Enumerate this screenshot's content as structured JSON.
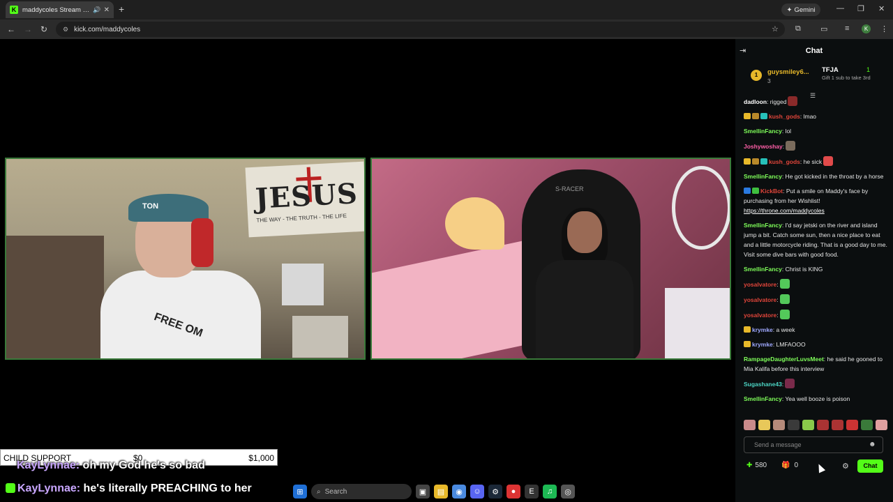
{
  "browser": {
    "tab_title": "maddycoles Stream - Watc",
    "favicon_letter": "K",
    "url": "kick.com/maddycoles",
    "gemini_label": "Gemini",
    "profile_initial": "K"
  },
  "overlay": {
    "support_label": "CHILD SUPPORT",
    "support_current": "$0",
    "support_goal": "$1,000",
    "lines": [
      {
        "name": "KayLynnae:",
        "text": " oh my God he's so bad"
      },
      {
        "name": "KayLynnae:",
        "text": " he's literally PREACHING to her"
      }
    ]
  },
  "cams": {
    "left_flag_text": "JESUS",
    "left_flag_sub": "THE WAY - THE TRUTH - THE LIFE",
    "left_cap_text": "TON",
    "left_shirt_text": "FREE  OM",
    "right_chair_text": "S-RACER"
  },
  "taskbar": {
    "search_placeholder": "Search"
  },
  "chat": {
    "title": "Chat",
    "leaderboard": {
      "first_rank": "1",
      "first_name": "guysmiley6...",
      "first_count": "3",
      "second_name": "TFJA",
      "second_count": "1",
      "second_sub": "Gift 1 sub to take 3rd"
    },
    "messages": [
      {
        "user": "dadloon",
        "color": "#ffffff",
        "text": " rigged",
        "badges": [],
        "emote": "#8a2a2a"
      },
      {
        "user": "kush_gods",
        "color": "#e0453a",
        "text": " lmao",
        "badges": [
          "#e8b92a",
          "#b9892a",
          "#27c0b9"
        ],
        "emote": ""
      },
      {
        "user": "SmellinFancy",
        "color": "#7fff5a",
        "text": " lol",
        "badges": [],
        "emote": ""
      },
      {
        "user": "Joshywoshay",
        "color": "#ff5fa8",
        "text": "",
        "badges": [],
        "emote": "#7a6b5c"
      },
      {
        "user": "kush_gods",
        "color": "#e0453a",
        "text": " he sick",
        "badges": [
          "#e8b92a",
          "#b9892a",
          "#27c0b9"
        ],
        "emote": "#e04a4a"
      },
      {
        "user": "SmellinFancy",
        "color": "#7fff5a",
        "text": " He got kicked in the throat by a horse",
        "badges": [],
        "emote": ""
      },
      {
        "user": "KickBot",
        "color": "#e0453a",
        "text": " Put a smile on Maddy's face by purchasing from her Wishlist! ",
        "link": "https://throne.com/maddycoles",
        "badges": [
          "#2a7ae0",
          "#3fbf3f"
        ],
        "emote": ""
      },
      {
        "user": "SmellinFancy",
        "color": "#7fff5a",
        "text": " I'd say jetski on the river and island jump a bit. Catch some sun, then a nice place to eat and a little motorcycle riding. That is a good day to me. Visit some dive bars with good food.",
        "badges": [],
        "emote": ""
      },
      {
        "user": "SmellinFancy",
        "color": "#7fff5a",
        "text": " Christ is KING",
        "badges": [],
        "emote": ""
      },
      {
        "user": "yosalvatore",
        "color": "#e0453a",
        "text": "",
        "badges": [],
        "emote": "#53c95a"
      },
      {
        "user": "yosalvatore",
        "color": "#e0453a",
        "text": "",
        "badges": [],
        "emote": "#53c95a"
      },
      {
        "user": "yosalvatore",
        "color": "#e0453a",
        "text": "",
        "badges": [],
        "emote": "#53c95a"
      },
      {
        "user": "krymke",
        "color": "#9fa8ff",
        "text": " a week",
        "badges": [
          "#e8b92a"
        ],
        "emote": ""
      },
      {
        "user": "krymke",
        "color": "#9fa8ff",
        "text": " LMFAOOO",
        "badges": [
          "#e8b92a"
        ],
        "emote": ""
      },
      {
        "user": "RampageDaughterLuvsMeet",
        "color": "#7fff5a",
        "text": " he said he gooned to Mia Kalifa before this interview",
        "badges": [],
        "emote": ""
      },
      {
        "user": "Sugashane43",
        "color": "#4bd4c3",
        "text": "",
        "badges": [],
        "emote": "#7a2a4a"
      },
      {
        "user": "SmellinFancy",
        "color": "#7fff5a",
        "text": " Yea well booze is poison",
        "badges": [],
        "emote": ""
      }
    ],
    "emote_bar_colors": [
      "#c98a8a",
      "#e8c85a",
      "#b58a7a",
      "#3a3a3a",
      "#8ac94a",
      "#a33",
      "#a33",
      "#c33",
      "#3a7a3a",
      "#e0a0a0"
    ],
    "input_placeholder": "Send a message",
    "points": "580",
    "gift_count": "0",
    "send_label": "Chat"
  }
}
